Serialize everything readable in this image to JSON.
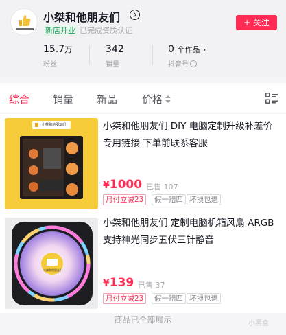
{
  "shop": {
    "name": "小桀和他朋友们",
    "badge": "新店开业",
    "verified_text": "已完成资质认证",
    "follow_label": "+ 关注",
    "avatar_icon": "thumbs-up-logo",
    "avatar_text": "小桀和他朋友们"
  },
  "stats": [
    {
      "value": "15.7",
      "unit": "万",
      "label": "粉丝"
    },
    {
      "value": "342",
      "unit": "",
      "label": "销量"
    },
    {
      "value": "0",
      "unit": "个作品",
      "label": "抖音号"
    }
  ],
  "tabs": [
    {
      "label": "综合",
      "active": true
    },
    {
      "label": "销量",
      "active": false
    },
    {
      "label": "新品",
      "active": false
    },
    {
      "label": "价格",
      "active": false
    }
  ],
  "products": [
    {
      "title": "小桀和他朋友们 DIY 电脑定制升级补差价专用链接 下单前联系客服",
      "price_symbol": "¥",
      "price": "1000",
      "sold": "已售 107",
      "tags": [
        "月付立减23",
        "假一赔四",
        "坏损包退"
      ],
      "image": "pc-case-image",
      "logo_text": "小桀和他朋友们"
    },
    {
      "title": "小桀和他朋友们 定制电脑机箱风扇 ARGB支持神光同步五伏三针静音",
      "price_symbol": "¥",
      "price": "139",
      "sold": "已售 37",
      "tags": [
        "月付立减23",
        "假一赔四",
        "坏损包退"
      ],
      "image": "rgb-fan-image",
      "logo_text": "小桀和他朋友们"
    }
  ],
  "footer_text": "商品已全部展示",
  "watermark": "小黑盒",
  "colors": {
    "accent": "#fe2c55",
    "badge_green": "#1e9e5a",
    "background": "#f5f5f7"
  }
}
